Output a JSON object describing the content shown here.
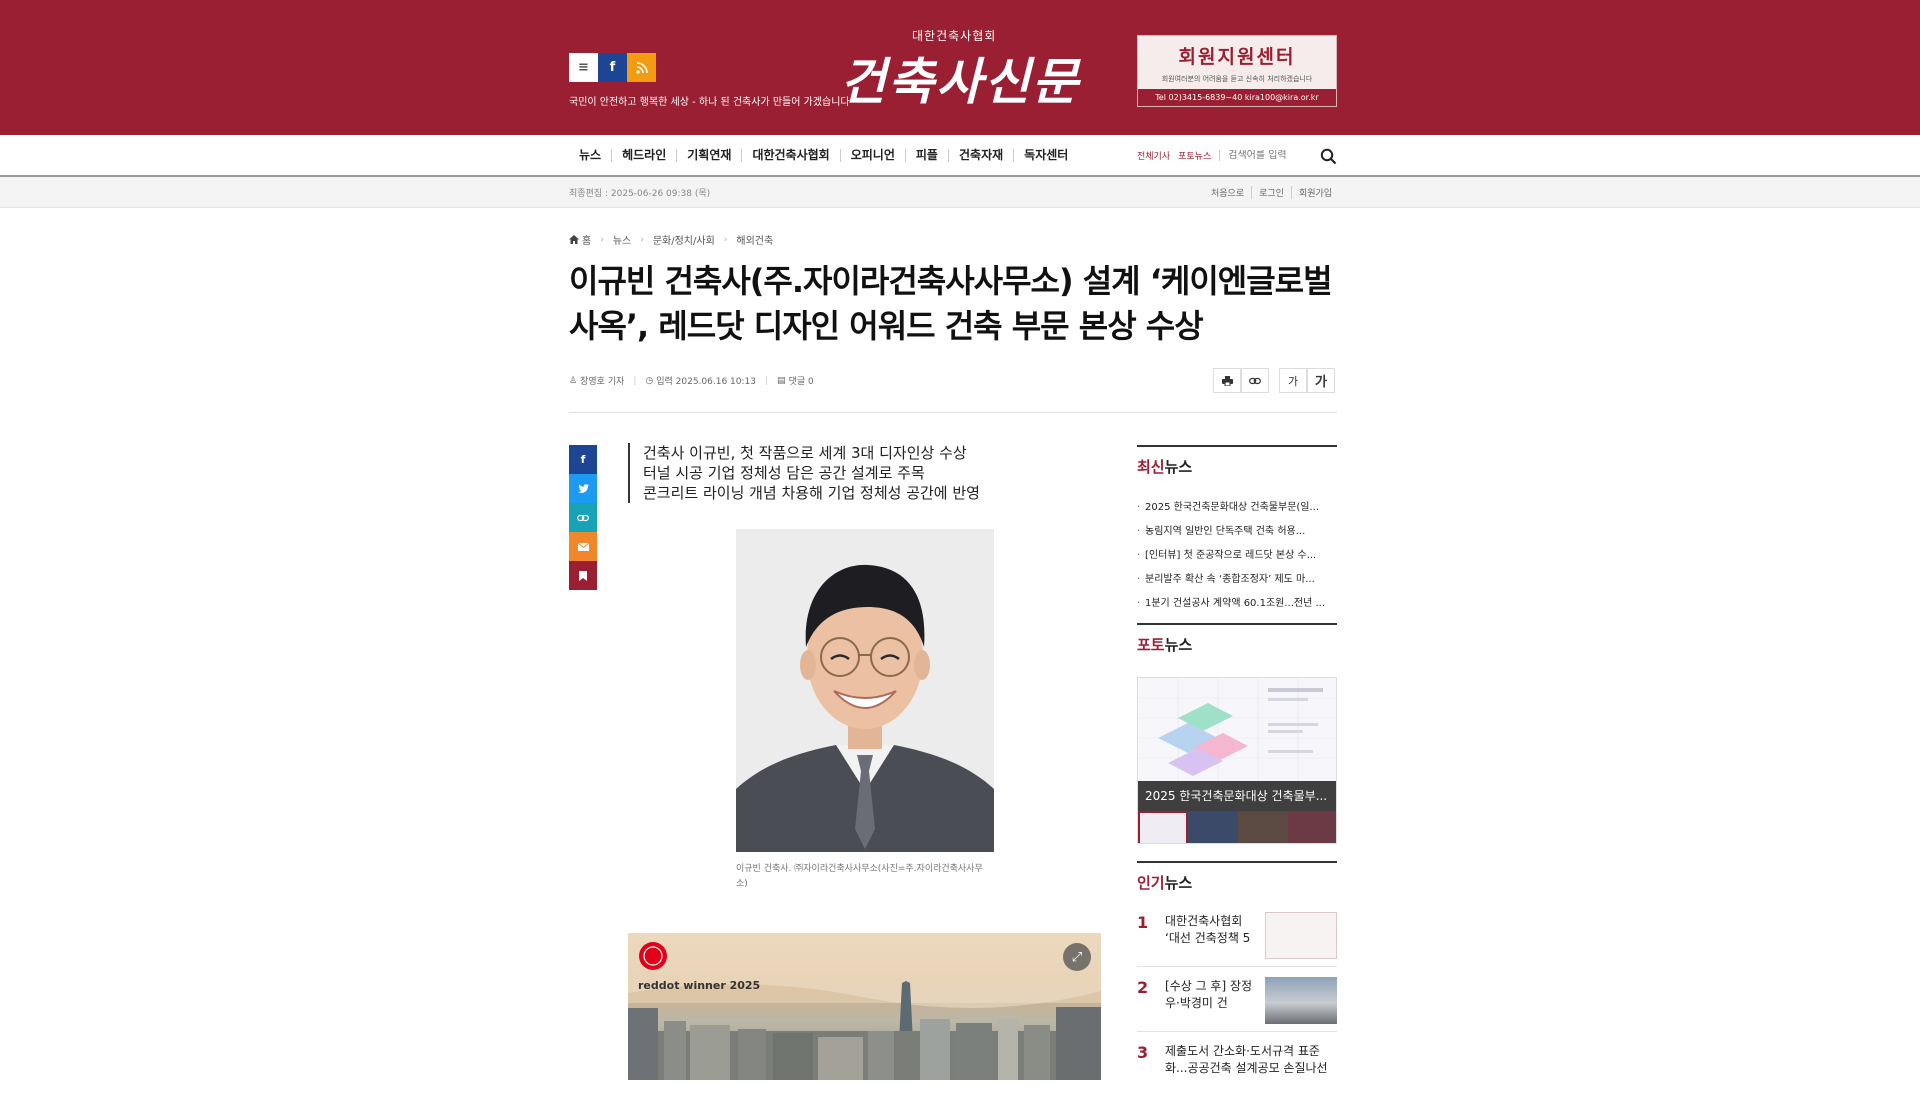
{
  "header": {
    "slogan": "국민이 안전하고 행복한 세상 - 하나 된 건축사가 만들어 가겠습니다",
    "logo_sub": "대한건축사협회",
    "logo_main": "건축사신문",
    "menu_icon": "menu-icon",
    "facebook_icon": "facebook-icon",
    "rss_icon": "rss-icon",
    "banner": {
      "title": "회원지원센터",
      "desc": "회원여러분의 어려움을 듣고 신속히 처리하겠습니다",
      "contact": "Tel 02)3415-6839~40   kira100@kira.or.kr"
    }
  },
  "nav": {
    "items": [
      "뉴스",
      "헤드라인",
      "기획연재",
      "대한건축사협회",
      "오피니언",
      "피플",
      "건축자재",
      "독자센터"
    ],
    "all_articles": "전체기사",
    "photo_news": "포토뉴스",
    "search_placeholder": "검색어를 입력"
  },
  "subbar": {
    "last_edit": "최종편집 : 2025-06-26 09:38 (목)",
    "links": [
      "처음으로",
      "로그인",
      "회원가입"
    ]
  },
  "breadcrumb": [
    "홈",
    "뉴스",
    "문화/정치/사회",
    "해외건축"
  ],
  "article": {
    "title": "이규빈 건축사(주.자이라건축사사무소) 설계 ‘케이엔글로벌 사옥’, 레드닷 디자인 어워드 건축 부문 본상 수상",
    "author": "장영호 기자",
    "date": "입력 2025.06.16 10:13",
    "comments": "댓글 0",
    "summary": [
      "건축사 이규빈, 첫 작품으로 세계 3대 디자인상 수상",
      "터널 시공 기업 정체성 담은 공간 설계로 주목",
      "콘크리트 라이닝 개념 차용해 기업 정체성 공간에 반영"
    ],
    "caption": "이규빈 건축사. ㈜자이라건축사사무소(사진=주.자이라건축사사무소)",
    "image2_badge": "reddot winner 2025",
    "font_small": "가",
    "font_large": "가"
  },
  "sidebar": {
    "latest_head_red": "최신",
    "latest_head": "뉴스",
    "latest": [
      "2025 한국건축문화대상 건축물부문(일...",
      "농림지역 일반인 단독주택 건축 허용...",
      "[인터뷰] 첫 준공작으로 레드닷 본상 수...",
      "분리발주 확산 속 ‘종합조정자’ 제도 마...",
      "1분기 건설공사 계약액 60.1조원...전년 ..."
    ],
    "photo_head_red": "포토",
    "photo_head": "뉴스",
    "photo_caption": "2025 한국건축문화대상 건축물부...",
    "popular_head_red": "인기",
    "popular_head": "뉴스",
    "popular": [
      {
        "num": "1",
        "text": "대한건축사협회 ‘대선 건축정책 5"
      },
      {
        "num": "2",
        "text": "[수상 그 후] 장정우·박경미 건"
      },
      {
        "num": "3",
        "text": "제출도서 간소화·도서규격 표준화...공공건축 설계공모 손질나선"
      }
    ]
  },
  "colors": {
    "brand": "#9a1f33",
    "facebook": "#1d4594",
    "twitter": "#1da1f2",
    "link": "#17a2b8",
    "mail": "#f0872b",
    "bookmark": "#9a1f33"
  }
}
